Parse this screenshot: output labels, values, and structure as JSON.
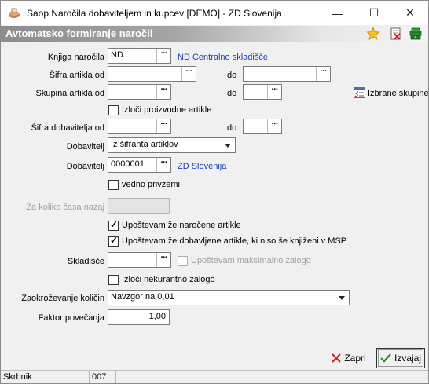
{
  "window": {
    "title": "Saop Naročila dobaviteljem in kupcev [DEMO] - ZD Slovenija",
    "minimize_glyph": "—",
    "maximize_glyph": "☐",
    "close_glyph": "✕"
  },
  "header": {
    "title": "Avtomatsko formiranje naročil",
    "icons": [
      "star-icon",
      "delete-document-icon",
      "books-icon"
    ]
  },
  "form": {
    "knjiga_label": "Knjiga naročila",
    "knjiga_value": "ND",
    "knjiga_desc": "ND Centralno skladišče",
    "sifra_artikla_label": "Šifra artikla od",
    "sifra_artikla_od": "",
    "do_label": "do",
    "sifra_artikla_do": "",
    "skupina_label": "Skupina artikla od",
    "skupina_od": "",
    "skupina_do": "",
    "izbrane_skupine_label": "Izbrane skupine",
    "izloci_proizvodne_label": "Izloči proizvodne artikle",
    "izloci_proizvodne_checked": false,
    "sifra_dobavitelja_label": "Šifra dobavitelja od",
    "sifra_dobavitelja_od": "",
    "sifra_dobavitelja_do": "",
    "dobavitelj_label": "Dobavitelj",
    "dobavitelj_mode": "Iz šifranta artiklov",
    "dobavitelj2_label": "Dobavitelj",
    "dobavitelj_value": "0000001",
    "dobavitelj_desc": "ZD Slovenija",
    "vedno_privzemi_label": "vedno privzemi",
    "vedno_privzemi_checked": false,
    "za_koliko_label": "Za koliko časa nazaj",
    "za_koliko_value": "",
    "upostevam_narocene_label": "Upoštevam že naročene artikle",
    "upostevam_narocene_checked": true,
    "upostevam_dobavljene_label": "Upoštevam že dobavljene artikle, ki niso še knjiženi v MSP",
    "upostevam_dobavljene_checked": true,
    "skladisce_label": "Skladišče",
    "skladisce_value": "",
    "upostevam_max_label": "Upoštevam maksimalno zalogo",
    "upostevam_max_checked": false,
    "izloci_nekurantno_label": "Izloči nekurantno zalogo",
    "izloci_nekurantno_checked": false,
    "zaokrozevanje_label": "Zaokroževanje količin",
    "zaokrozevanje_value": "Navzgor na 0,01",
    "faktor_label": "Faktor povečanja",
    "faktor_value": "1,00",
    "ellipsis": "···"
  },
  "buttons": {
    "zapri": "Zapri",
    "izvajaj": "Izvajaj"
  },
  "status": {
    "user": "Skrbnik",
    "code": "007"
  },
  "colors": {
    "link": "#1a3fb5",
    "header_gradient_start": "#8d8d8d"
  }
}
